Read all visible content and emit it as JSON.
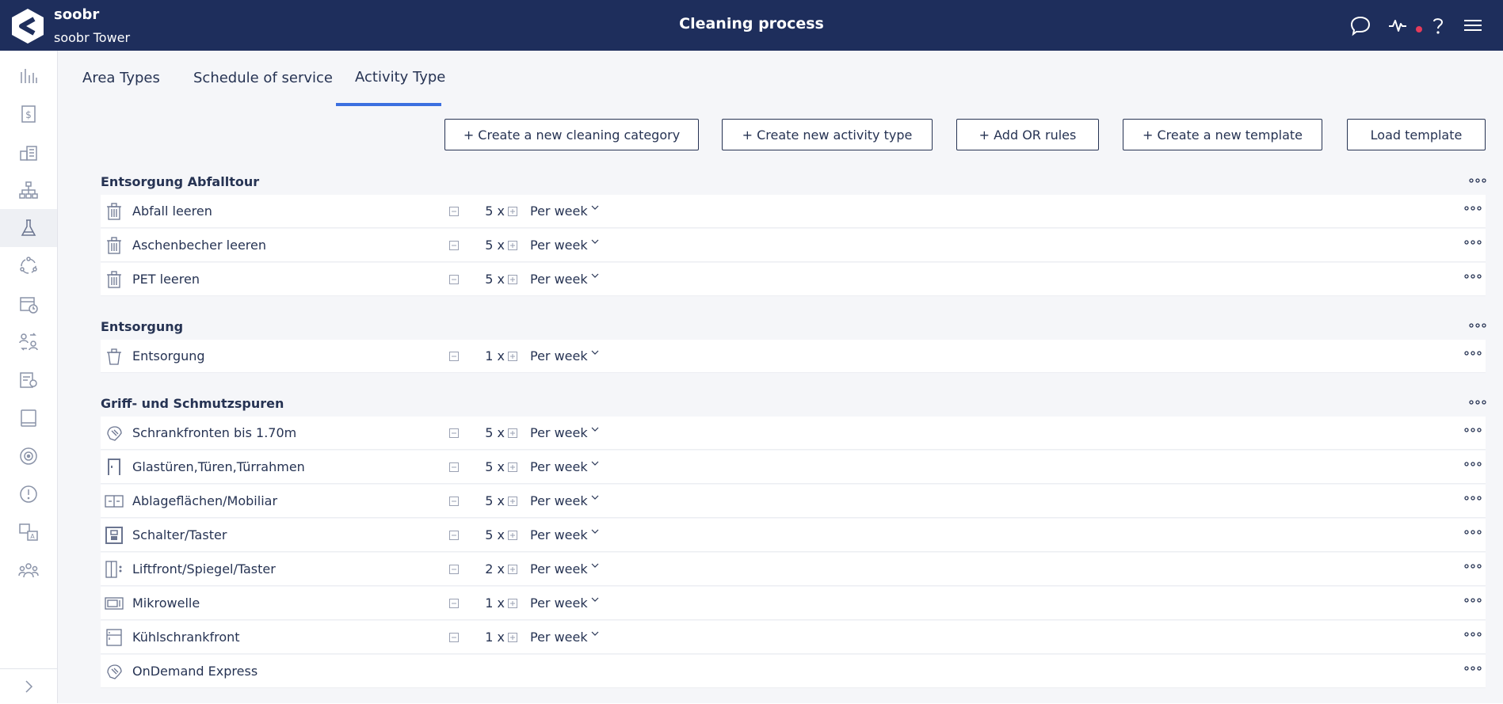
{
  "header": {
    "brand": "soobr",
    "building": "soobr Tower",
    "title": "Cleaning process"
  },
  "tabs": [
    {
      "label": "Area Types",
      "active": false
    },
    {
      "label": "Schedule of service",
      "active": false
    },
    {
      "label": "Activity Type",
      "active": true
    }
  ],
  "toolbar": {
    "create_category": "+ Create a new cleaning category",
    "create_activity": "+ Create new activity type",
    "add_or_rules": "+ Add OR rules",
    "create_template": "+ Create a new template",
    "load_template": "Load template"
  },
  "categories": [
    {
      "name": "Entsorgung Abfalltour",
      "activities": [
        {
          "name": "Abfall leeren",
          "count": "5 x",
          "frequency": "Per week",
          "icon": "trash-bin-icon"
        },
        {
          "name": "Aschenbecher leeren",
          "count": "5 x",
          "frequency": "Per week",
          "icon": "trash-bin-icon"
        },
        {
          "name": "PET leeren",
          "count": "5 x",
          "frequency": "Per week",
          "icon": "trash-bin-icon"
        }
      ]
    },
    {
      "name": "Entsorgung",
      "activities": [
        {
          "name": "Entsorgung",
          "count": "1 x",
          "frequency": "Per week",
          "icon": "bin-icon"
        }
      ]
    },
    {
      "name": "Griff- und Schmutzspuren",
      "activities": [
        {
          "name": "Schrankfronten bis 1.70m",
          "count": "5 x",
          "frequency": "Per week",
          "icon": "hand-wipe-icon"
        },
        {
          "name": "Glastüren,Türen,Türrahmen",
          "count": "5 x",
          "frequency": "Per week",
          "icon": "door-icon"
        },
        {
          "name": "Ablageflächen/Mobiliar",
          "count": "5 x",
          "frequency": "Per week",
          "icon": "shelf-icon"
        },
        {
          "name": "Schalter/Taster",
          "count": "5 x",
          "frequency": "Per week",
          "icon": "switch-icon"
        },
        {
          "name": "Liftfront/Spiegel/Taster",
          "count": "2 x",
          "frequency": "Per week",
          "icon": "elevator-icon"
        },
        {
          "name": "Mikrowelle",
          "count": "1 x",
          "frequency": "Per week",
          "icon": "microwave-icon"
        },
        {
          "name": "Kühlschrankfront",
          "count": "1 x",
          "frequency": "Per week",
          "icon": "fridge-icon"
        },
        {
          "name": "OnDemand Express",
          "icon": "hand-wipe-icon"
        }
      ]
    }
  ],
  "colors": {
    "header_bg": "#1e2e5c",
    "accent": "#3b6fe0",
    "text": "#263353",
    "notification": "#e63b5a"
  }
}
